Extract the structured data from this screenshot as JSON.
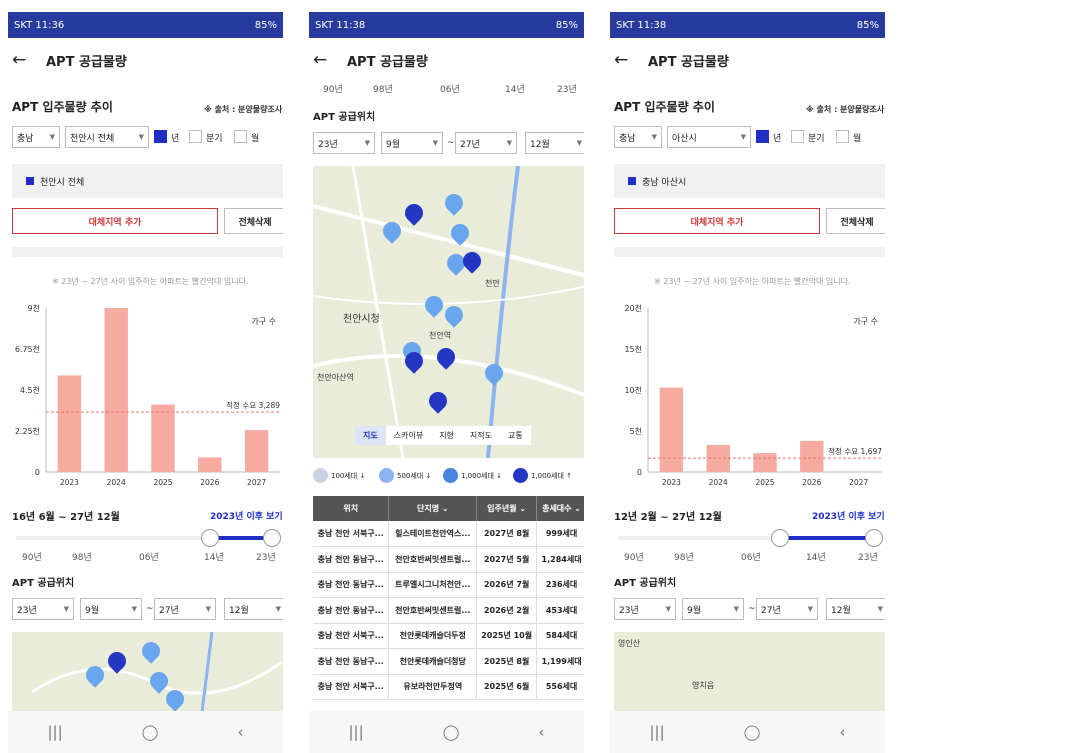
{
  "status": {
    "s1": "SKT 11:36",
    "s2": "SKT 11:38",
    "s3": "SKT 11:38",
    "battery": "85%"
  },
  "header": {
    "title": "APT 공급물량",
    "back": "←"
  },
  "trend": {
    "title": "APT 입주물량 추이",
    "source": "※ 출처 : 분양물량조사"
  },
  "p1": {
    "sido": "충남",
    "sigungu": "천안시 전체",
    "region": "천안시 전체",
    "chart": {
      "ylabels": [
        "9천",
        "6.75천",
        "4.5천",
        "2.25천",
        "0"
      ],
      "max": 9000,
      "series_label": "가구 수",
      "demand_label": "적정 수요 3,289",
      "demand": 3289
    }
  },
  "p3": {
    "sido": "충남",
    "sigungu": "아산시",
    "region": "충남 아산시",
    "chart": {
      "ylabels": [
        "20천",
        "15천",
        "10천",
        "5천",
        "0"
      ],
      "max": 20000,
      "series_label": "가구 수",
      "demand_label": "적정 수요 1,697",
      "demand": 1697
    }
  },
  "period": {
    "year": "년",
    "quarter": "분기",
    "month": "월"
  },
  "buttons": {
    "add": "대체지역 추가",
    "delete": "전체삭제",
    "after2023": "2023년 이후 보기"
  },
  "note": "※ 23년 ~ 27년 사이 입주하는 아파트는 빨간막대 입니다.",
  "range1": "16년 6월 ~ 27년 12월",
  "range3": "12년 2월 ~ 27년 12월",
  "ticks": [
    "90년",
    "98년",
    "06년",
    "14년",
    "23년"
  ],
  "location": {
    "title": "APT 공급위치",
    "from_year": "23년",
    "from_month": "9월",
    "to_year": "27년",
    "to_month": "12월",
    "tilde": "~"
  },
  "maptabs": [
    "지도",
    "스카이뷰",
    "지형",
    "지적도",
    "교통"
  ],
  "maplabels": {
    "city_hall": "천안시청",
    "station": "천안역",
    "asan_station": "천안아산역",
    "cheonan": "천안",
    "p3_a": "영인산",
    "p3_b": "영치읍"
  },
  "legend": [
    "100세대 ↓",
    "500세대 ↓",
    "1,000세대 ↓",
    "1,000세대 ↑"
  ],
  "table": {
    "headers": [
      "위치",
      "단지명 ⌄",
      "입주년월 ⌄",
      "총세대수 ⌄"
    ],
    "rows": [
      [
        "충남 천안 서북구...",
        "힐스테이트천안역스...",
        "2027년 8월",
        "999세대"
      ],
      [
        "충남 천안 동남구...",
        "천안호반써밋센트럴...",
        "2027년 5월",
        "1,284세대"
      ],
      [
        "충남 천안 동남구...",
        "트루엘시그니처천안...",
        "2026년 7월",
        "236세대"
      ],
      [
        "충남 천안 동남구...",
        "천안호반써밋센트럴...",
        "2026년 2월",
        "453세대"
      ],
      [
        "충남 천안 서북구...",
        "천안롯데캐슬더두정",
        "2025년 10월",
        "584세대"
      ],
      [
        "충남 천안 동남구...",
        "천안롯데캐슬더청당",
        "2025년 8월",
        "1,199세대"
      ],
      [
        "충남 천안 서북구...",
        "유보라천안두정역",
        "2025년 6월",
        "556세대"
      ]
    ]
  },
  "nav": [
    "|||",
    "◯",
    "‹"
  ],
  "chart_data": [
    {
      "type": "bar",
      "categories": [
        "2023",
        "2024",
        "2025",
        "2026",
        "2027"
      ],
      "values": [
        5300,
        9000,
        3700,
        800,
        2300
      ],
      "ylim": [
        0,
        9000
      ],
      "legend": "가구 수",
      "annotations": [
        "적정 수요 3,289"
      ]
    },
    {
      "type": "bar",
      "categories": [
        "2023",
        "2024",
        "2025",
        "2026",
        "2027"
      ],
      "values": [
        10300,
        3300,
        2300,
        3800,
        0
      ],
      "ylim": [
        0,
        20000
      ],
      "legend": "가구 수",
      "annotations": [
        "적정 수요 1,697"
      ]
    }
  ],
  "colors": {
    "bar": "#f6aaa0",
    "demand_line": "#e07a6a",
    "accent": "#1f2fc5",
    "status": "#273a9e"
  }
}
